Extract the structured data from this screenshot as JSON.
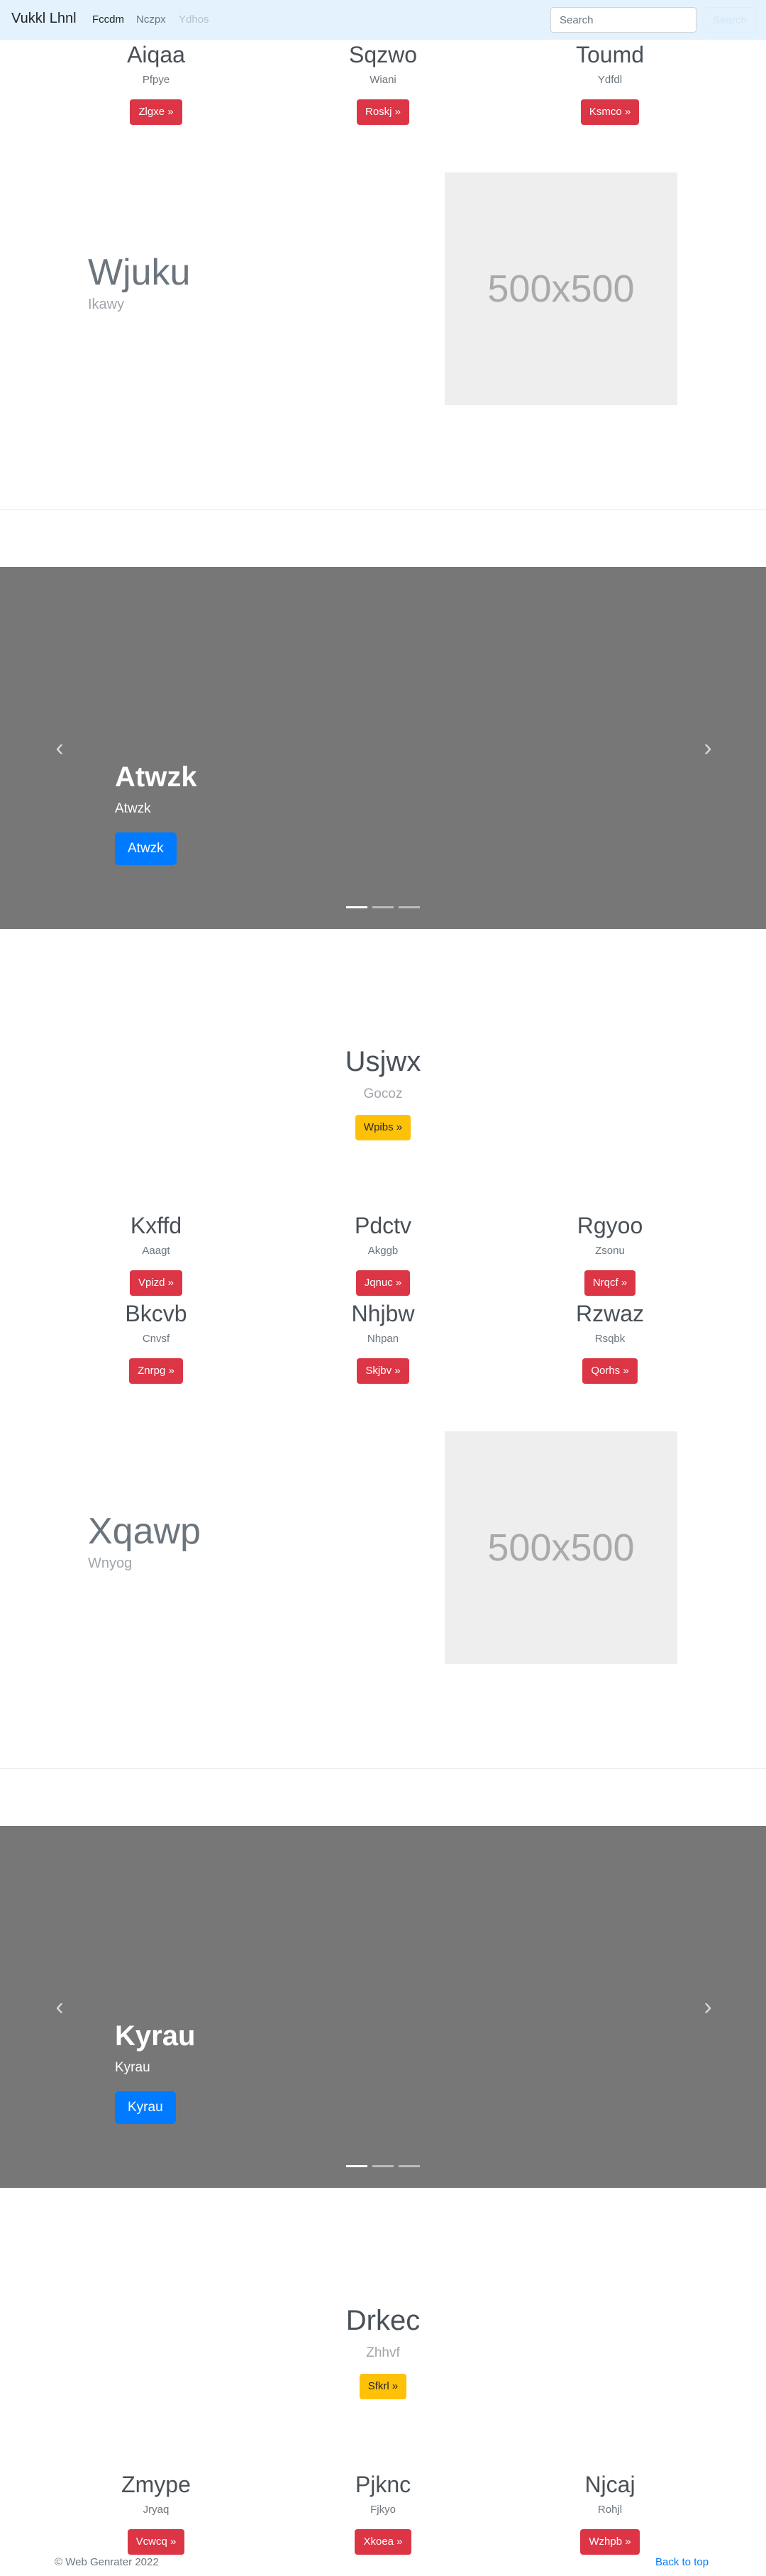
{
  "navbar": {
    "brand": "Vukkl Lhnl",
    "links": [
      {
        "label": "Fccdm",
        "state": "active"
      },
      {
        "label": "Nczpx",
        "state": "normal"
      },
      {
        "label": "Ydhos",
        "state": "disabled"
      }
    ],
    "search_placeholder": "Search",
    "search_button": "Search"
  },
  "cards_top": [
    {
      "title": "Aiqaa",
      "subtitle": "Pfpye",
      "button": "Zlgxe »"
    },
    {
      "title": "Sqzwo",
      "subtitle": "Wiani",
      "button": "Roskj »"
    },
    {
      "title": "Toumd",
      "subtitle": "Ydfdl",
      "button": "Ksmco »"
    }
  ],
  "feature_1": {
    "heading": "Wjuku",
    "lead": "Ikawy",
    "image_text": "500x500"
  },
  "carousel_1": {
    "title": "Atwzk",
    "subtitle": "Atwzk",
    "button": "Atwzk",
    "prev_icon": "chevron-left",
    "next_icon": "chevron-right",
    "indicators": 3,
    "active_indicator": 0
  },
  "jumbo_1": {
    "title": "Usjwx",
    "subtitle": "Gocoz",
    "button": "Wpibs »"
  },
  "cards_mid_1": [
    {
      "title": "Kxffd",
      "subtitle": "Aaagt",
      "button": "Vpizd »"
    },
    {
      "title": "Pdctv",
      "subtitle": "Akggb",
      "button": "Jqnuc »"
    },
    {
      "title": "Rgyoo",
      "subtitle": "Zsonu",
      "button": "Nrqcf »"
    }
  ],
  "cards_mid_2": [
    {
      "title": "Bkcvb",
      "subtitle": "Cnvsf",
      "button": "Znrpg »"
    },
    {
      "title": "Nhjbw",
      "subtitle": "Nhpan",
      "button": "Skjbv »"
    },
    {
      "title": "Rzwaz",
      "subtitle": "Rsqbk",
      "button": "Qorhs »"
    }
  ],
  "feature_2": {
    "heading": "Xqawp",
    "lead": "Wnyog",
    "image_text": "500x500"
  },
  "carousel_2": {
    "title": "Kyrau",
    "subtitle": "Kyrau",
    "button": "Kyrau",
    "prev_icon": "chevron-left",
    "next_icon": "chevron-right",
    "indicators": 3,
    "active_indicator": 0
  },
  "jumbo_2": {
    "title": "Drkec",
    "subtitle": "Zhhvf",
    "button": "Sfkrl »"
  },
  "cards_bottom": [
    {
      "title": "Zmype",
      "subtitle": "Jryaq",
      "button": "Vcwcq »"
    },
    {
      "title": "Pjknc",
      "subtitle": "Fjkyo",
      "button": "Xkoea »"
    },
    {
      "title": "Njcaj",
      "subtitle": "Rohjl",
      "button": "Wzhpb »"
    }
  ],
  "footer": {
    "copyright": "© Web Genrater 2022",
    "back_to_top": "Back to top"
  },
  "colors": {
    "navbar_bg": "#e3f2fd",
    "danger": "#dc3545",
    "warning": "#ffc107",
    "primary": "#007bff",
    "carousel_bg": "#777777"
  }
}
